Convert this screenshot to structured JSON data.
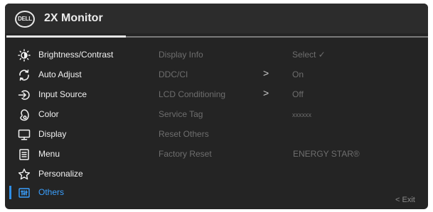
{
  "header": {
    "logo_text": "DELL",
    "title": "2X Monitor"
  },
  "menu": [
    {
      "label": "Brightness/Contrast",
      "icon": "brightness-icon"
    },
    {
      "label": "Auto Adjust",
      "icon": "auto-adjust-icon"
    },
    {
      "label": "Input Source",
      "icon": "input-source-icon"
    },
    {
      "label": "Color",
      "icon": "color-icon"
    },
    {
      "label": "Display",
      "icon": "display-icon"
    },
    {
      "label": "Menu",
      "icon": "menu-icon"
    },
    {
      "label": "Personalize",
      "icon": "star-icon"
    },
    {
      "label": "Others",
      "icon": "others-icon",
      "active": true
    }
  ],
  "others": {
    "display_info": {
      "label": "Display Info",
      "value": "Select ✓"
    },
    "ddc_ci": {
      "label": "DDC/CI",
      "value": "On",
      "chevron": ">"
    },
    "lcd_conditioning": {
      "label": "LCD Conditioning",
      "value": "Off",
      "chevron": ">"
    },
    "service_tag": {
      "label": "Service Tag",
      "value": "xxxxxx"
    },
    "reset_others": {
      "label": "Reset Others"
    },
    "factory_reset": {
      "label": "Factory Reset",
      "value": "ENERGY STAR®"
    }
  },
  "footer": {
    "exit_label": "< Exit"
  },
  "colors": {
    "panel": "#242424",
    "accent": "#3aa0ff",
    "active_bar": "#2f8fe8"
  }
}
